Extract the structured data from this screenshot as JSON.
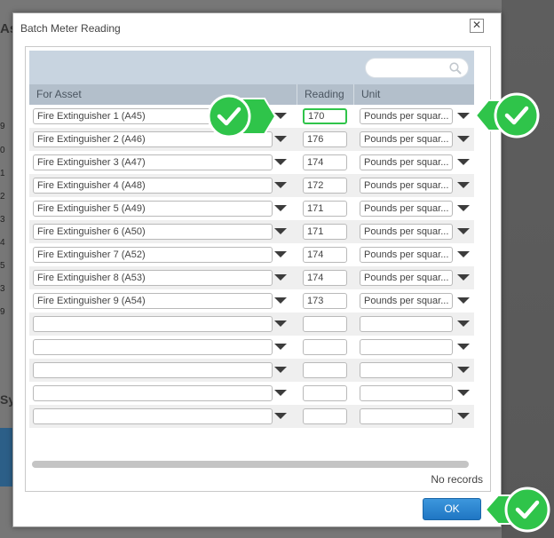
{
  "dialog": {
    "title": "Batch Meter Reading",
    "close_glyph": "✕",
    "ok_label": "OK"
  },
  "search": {
    "placeholder": ""
  },
  "grid": {
    "columns": [
      "For Asset",
      "Reading",
      "Unit"
    ],
    "rows": [
      {
        "asset": "Fire Extinguisher 1 (A45)",
        "reading": "170",
        "unit": "Pounds per squar..."
      },
      {
        "asset": "Fire Extinguisher 2 (A46)",
        "reading": "176",
        "unit": "Pounds per squar..."
      },
      {
        "asset": "Fire Extinguisher 3 (A47)",
        "reading": "174",
        "unit": "Pounds per squar..."
      },
      {
        "asset": "Fire Extinguisher 4 (A48)",
        "reading": "172",
        "unit": "Pounds per squar..."
      },
      {
        "asset": "Fire Extinguisher 5 (A49)",
        "reading": "171",
        "unit": "Pounds per squar..."
      },
      {
        "asset": "Fire Extinguisher 6 (A50)",
        "reading": "171",
        "unit": "Pounds per squar..."
      },
      {
        "asset": "Fire Extinguisher 7 (A52)",
        "reading": "174",
        "unit": "Pounds per squar..."
      },
      {
        "asset": "Fire Extinguisher 8 (A53)",
        "reading": "174",
        "unit": "Pounds per squar..."
      },
      {
        "asset": "Fire Extinguisher 9 (A54)",
        "reading": "173",
        "unit": "Pounds per squar..."
      },
      {
        "asset": "",
        "reading": "",
        "unit": ""
      },
      {
        "asset": "",
        "reading": "",
        "unit": ""
      },
      {
        "asset": "",
        "reading": "",
        "unit": ""
      },
      {
        "asset": "",
        "reading": "",
        "unit": ""
      },
      {
        "asset": "",
        "reading": "",
        "unit": ""
      }
    ],
    "status_text": "No records"
  },
  "background": {
    "title_fragment": "As",
    "side_numbers": [
      "9",
      "0",
      "1",
      "2",
      "3",
      "4",
      "5",
      "3",
      "9"
    ],
    "lower_fragment": "Sys"
  },
  "colors": {
    "accent_green": "#2fc44a",
    "ok_blue": "#1f76c3",
    "header_blue": "#b3bfcb"
  },
  "icons": {
    "search": "search-icon",
    "close": "close-icon",
    "callout": "check-callout-icon"
  }
}
